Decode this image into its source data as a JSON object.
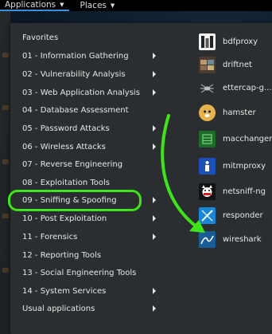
{
  "topbar": {
    "applications_label": "Applications",
    "places_label": "Places"
  },
  "menu": {
    "categories": [
      {
        "label": "Favorites",
        "submenu": false
      },
      {
        "label": "01 - Information Gathering",
        "submenu": true
      },
      {
        "label": "02 - Vulnerability Analysis",
        "submenu": true
      },
      {
        "label": "03 - Web Application Analysis",
        "submenu": true
      },
      {
        "label": "04 - Database Assessment",
        "submenu": false
      },
      {
        "label": "05 - Password Attacks",
        "submenu": true
      },
      {
        "label": "06 - Wireless Attacks",
        "submenu": true
      },
      {
        "label": "07 - Reverse Engineering",
        "submenu": false
      },
      {
        "label": "08 - Exploitation Tools",
        "submenu": false
      },
      {
        "label": "09 - Sniffing & Spoofing",
        "submenu": true
      },
      {
        "label": "10 - Post Exploitation",
        "submenu": true
      },
      {
        "label": "11 - Forensics",
        "submenu": true
      },
      {
        "label": "12 - Reporting Tools",
        "submenu": false
      },
      {
        "label": "13 - Social Engineering Tools",
        "submenu": false
      },
      {
        "label": "14 - System Services",
        "submenu": true
      },
      {
        "label": "Usual applications",
        "submenu": true
      }
    ],
    "highlighted_category": "09 - Sniffing & Spoofing",
    "apps": [
      {
        "label": "bdfproxy",
        "icon": "bdfproxy-icon"
      },
      {
        "label": "driftnet",
        "icon": "driftnet-icon"
      },
      {
        "label": "ettercap-g...",
        "icon": "ettercap-icon"
      },
      {
        "label": "hamster",
        "icon": "hamster-icon"
      },
      {
        "label": "macchanger",
        "icon": "macchanger-icon"
      },
      {
        "label": "mitmproxy",
        "icon": "mitmproxy-icon"
      },
      {
        "label": "netsniff-ng",
        "icon": "netsniff-icon"
      },
      {
        "label": "responder",
        "icon": "responder-icon"
      },
      {
        "label": "wireshark",
        "icon": "wireshark-icon"
      }
    ]
  },
  "colors": {
    "highlight": "#3fe31a",
    "menu_bg": "#2b2e30",
    "text": "#e6e6e6"
  }
}
